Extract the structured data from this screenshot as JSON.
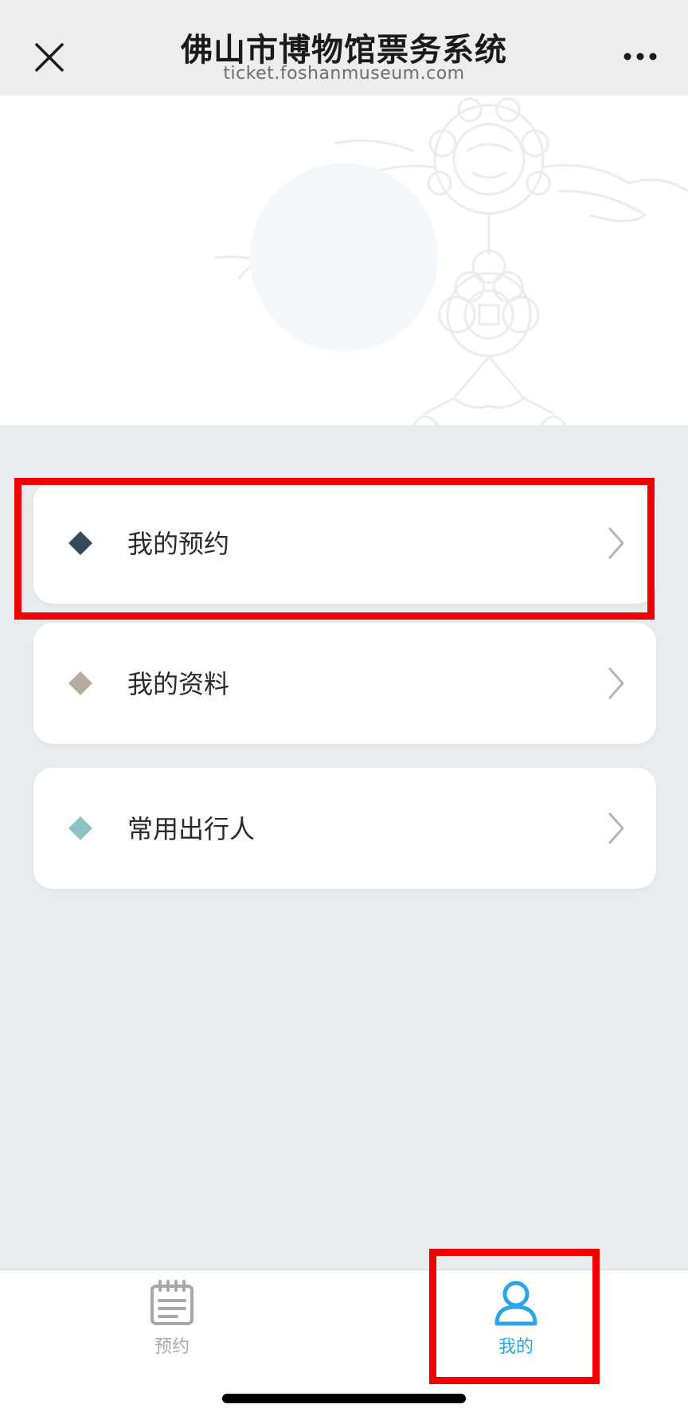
{
  "header": {
    "title": "佛山市博物馆票务系统",
    "subtitle": "ticket.foshanmuseum.com",
    "close_icon": "close-icon",
    "more_icon": "more-icon"
  },
  "menu": {
    "items": [
      {
        "label": "我的预约",
        "diamond_color": "#34495e"
      },
      {
        "label": "我的资料",
        "diamond_color": "#b9ab9b"
      },
      {
        "label": "常用出行人",
        "diamond_color": "#8ec1c2"
      }
    ]
  },
  "tabbar": {
    "tabs": [
      {
        "label": "预约",
        "icon": "calendar-icon",
        "color": "#a8a8a8"
      },
      {
        "label": "我的",
        "icon": "user-icon",
        "color": "#2aa6e8"
      }
    ]
  },
  "colors": {
    "highlight": "#f20000",
    "active_tab": "#2aa6e8"
  }
}
